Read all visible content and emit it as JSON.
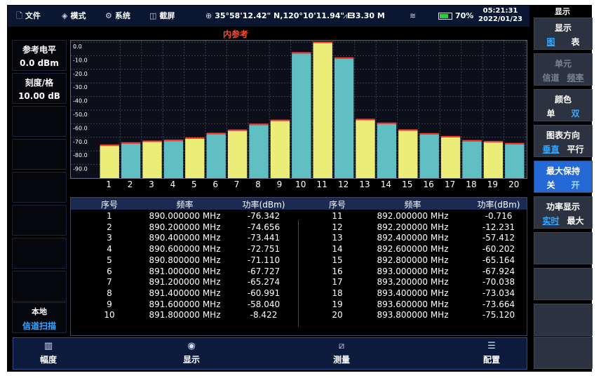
{
  "status_bar": {
    "file": "文件",
    "mode": "模式",
    "system": "系统",
    "screenshot": "截屏",
    "gps": "35°58'12.42\" N,120°10'11.94\" E",
    "altitude": "33.30 M",
    "battery": "70%",
    "time": "05:21:31",
    "date": "2022/01/23"
  },
  "left_panel": {
    "ref_level_label": "参考电平",
    "ref_level_value": "0.0 dBm",
    "scale_label": "刻度/格",
    "scale_value": "10.00 dB",
    "source_label": "本地",
    "source_value": "信道扫描"
  },
  "chart_title": "内参考",
  "chart_data": {
    "type": "bar",
    "categories": [
      "1",
      "2",
      "3",
      "4",
      "5",
      "6",
      "7",
      "8",
      "9",
      "10",
      "11",
      "12",
      "13",
      "14",
      "15",
      "16",
      "17",
      "18",
      "19",
      "20"
    ],
    "values": [
      -76.342,
      -74.656,
      -73.441,
      -72.751,
      -71.11,
      -67.727,
      -65.274,
      -60.991,
      -58.04,
      -8.422,
      -0.716,
      -12.231,
      -57.412,
      -60.202,
      -65.164,
      -67.924,
      -70.038,
      -73.034,
      -73.664,
      -75.12
    ],
    "y_tick_labels": [
      "0.0",
      "-10.0",
      "-20.0",
      "-30.0",
      "-40.0",
      "-50.0",
      "-60.0",
      "-70.0",
      "-80.0",
      "-90.0"
    ],
    "ylim": [
      -100,
      0
    ],
    "grid": true,
    "colors": {
      "odd": "#ecec78",
      "even": "#5fbfc3",
      "peak": "#ff3b30"
    }
  },
  "table": {
    "headers": [
      "序号",
      "频率",
      "功率(dBm)",
      "序号",
      "频率",
      "功率(dBm)"
    ],
    "rows_left": [
      [
        "1",
        "890.000000 MHz",
        "-76.342"
      ],
      [
        "2",
        "890.200000 MHz",
        "-74.656"
      ],
      [
        "3",
        "890.400000 MHz",
        "-73.441"
      ],
      [
        "4",
        "890.600000 MHz",
        "-72.751"
      ],
      [
        "5",
        "890.800000 MHz",
        "-71.110"
      ],
      [
        "6",
        "891.000000 MHz",
        "-67.727"
      ],
      [
        "7",
        "891.200000 MHz",
        "-65.274"
      ],
      [
        "8",
        "891.400000 MHz",
        "-60.991"
      ],
      [
        "9",
        "891.600000 MHz",
        "-58.040"
      ],
      [
        "10",
        "891.800000 MHz",
        "-8.422"
      ]
    ],
    "rows_right": [
      [
        "11",
        "892.000000 MHz",
        "-0.716"
      ],
      [
        "12",
        "892.200000 MHz",
        "-12.231"
      ],
      [
        "13",
        "892.400000 MHz",
        "-57.412"
      ],
      [
        "14",
        "892.600000 MHz",
        "-60.202"
      ],
      [
        "15",
        "892.800000 MHz",
        "-65.164"
      ],
      [
        "16",
        "893.000000 MHz",
        "-67.924"
      ],
      [
        "17",
        "893.200000 MHz",
        "-70.038"
      ],
      [
        "18",
        "893.400000 MHz",
        "-73.034"
      ],
      [
        "19",
        "893.600000 MHz",
        "-73.664"
      ],
      [
        "20",
        "893.800000 MHz",
        "-75.120"
      ]
    ]
  },
  "bottom_menu": {
    "amplitude": "幅度",
    "display": "显示",
    "measure": "测量",
    "config": "配置"
  },
  "right_panel": {
    "header": "显示",
    "btn_display": {
      "title": "显示",
      "opt1": "图",
      "opt2": "表"
    },
    "btn_unit": {
      "title": "单元",
      "opt1": "信道",
      "opt2": "频率"
    },
    "btn_color": {
      "title": "颜色",
      "opt1": "单",
      "opt2": "双"
    },
    "btn_orientation": {
      "title": "图表方向",
      "opt1": "垂直",
      "opt2": "平行"
    },
    "btn_maxhold": {
      "title": "最大保持",
      "opt1": "关",
      "opt2": "开"
    },
    "btn_power": {
      "title": "功率显示",
      "opt1": "实时",
      "opt2": "最大"
    }
  }
}
